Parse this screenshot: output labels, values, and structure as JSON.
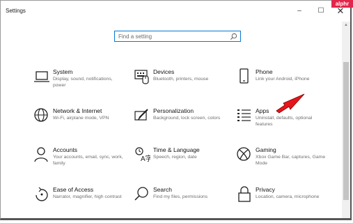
{
  "window": {
    "title": "Settings",
    "minimize": "–",
    "maximize": "☐",
    "close": "✕"
  },
  "badge": "alphr",
  "search": {
    "placeholder": "Find a setting"
  },
  "tiles": [
    {
      "name": "System",
      "desc": "Display, sound, notifications, power",
      "icon": "laptop-icon"
    },
    {
      "name": "Devices",
      "desc": "Bluetooth, printers, mouse",
      "icon": "keyboard-icon"
    },
    {
      "name": "Phone",
      "desc": "Link your Android, iPhone",
      "icon": "phone-icon"
    },
    {
      "name": "Network & Internet",
      "desc": "Wi-Fi, airplane mode, VPN",
      "icon": "globe-icon"
    },
    {
      "name": "Personalization",
      "desc": "Background, lock screen, colors",
      "icon": "paintbrush-icon"
    },
    {
      "name": "Apps",
      "desc": "Uninstall, defaults, optional features",
      "icon": "apps-list-icon"
    },
    {
      "name": "Accounts",
      "desc": "Your accounts, email, sync, work, family",
      "icon": "person-icon"
    },
    {
      "name": "Time & Language",
      "desc": "Speech, region, date",
      "icon": "time-language-icon"
    },
    {
      "name": "Gaming",
      "desc": "Xbox Game Bar, captures, Game Mode",
      "icon": "xbox-icon"
    },
    {
      "name": "Ease of Access",
      "desc": "Narrator, magnifier, high contrast",
      "icon": "ease-of-access-icon"
    },
    {
      "name": "Search",
      "desc": "Find my files, permissions",
      "icon": "search-icon"
    },
    {
      "name": "Privacy",
      "desc": "Location, camera, microphone",
      "icon": "lock-icon"
    }
  ],
  "colors": {
    "accent": "#0078d7",
    "annotation": "#e8141b"
  }
}
